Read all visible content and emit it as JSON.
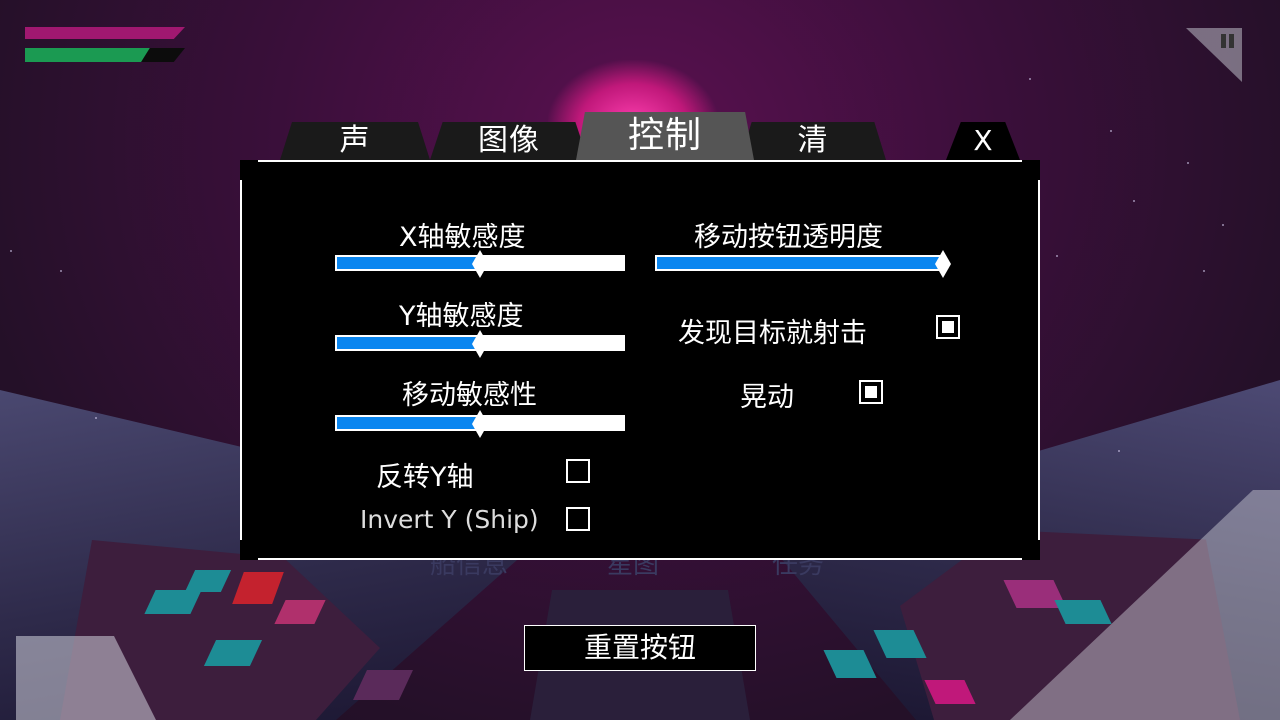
{
  "tabs": [
    {
      "label": "声",
      "active": false
    },
    {
      "label": "图像",
      "active": false
    },
    {
      "label": "控制",
      "active": true
    },
    {
      "label": "清",
      "active": false
    }
  ],
  "close_label": "X",
  "settings": {
    "x_sensitivity": {
      "label": "X轴敏感度",
      "value": 0.5
    },
    "y_sensitivity": {
      "label": "Y轴敏感度",
      "value": 0.5
    },
    "move_sensitivity": {
      "label": "移动敏感性",
      "value": 0.5
    },
    "button_opacity": {
      "label": "移动按钮透明度",
      "value": 1.0
    },
    "invert_y": {
      "label": "反转Y轴",
      "checked": false
    },
    "invert_y_ship": {
      "label": "Invert Y (Ship)",
      "checked": false
    },
    "fire_on_sight": {
      "label": "发现目标就射击",
      "checked": true
    },
    "shake": {
      "label": "晃动",
      "checked": true
    }
  },
  "background_menu": [
    "船信息",
    "星图",
    "任务"
  ],
  "reset_button_label": "重置按钮",
  "hud": {
    "shield_level": 1.0,
    "health_level": 0.78,
    "shield_color": "#a01870",
    "health_color": "#1b9a52"
  },
  "colors": {
    "slider_fill": "#0a86f0",
    "panel_bg": "#000000"
  }
}
